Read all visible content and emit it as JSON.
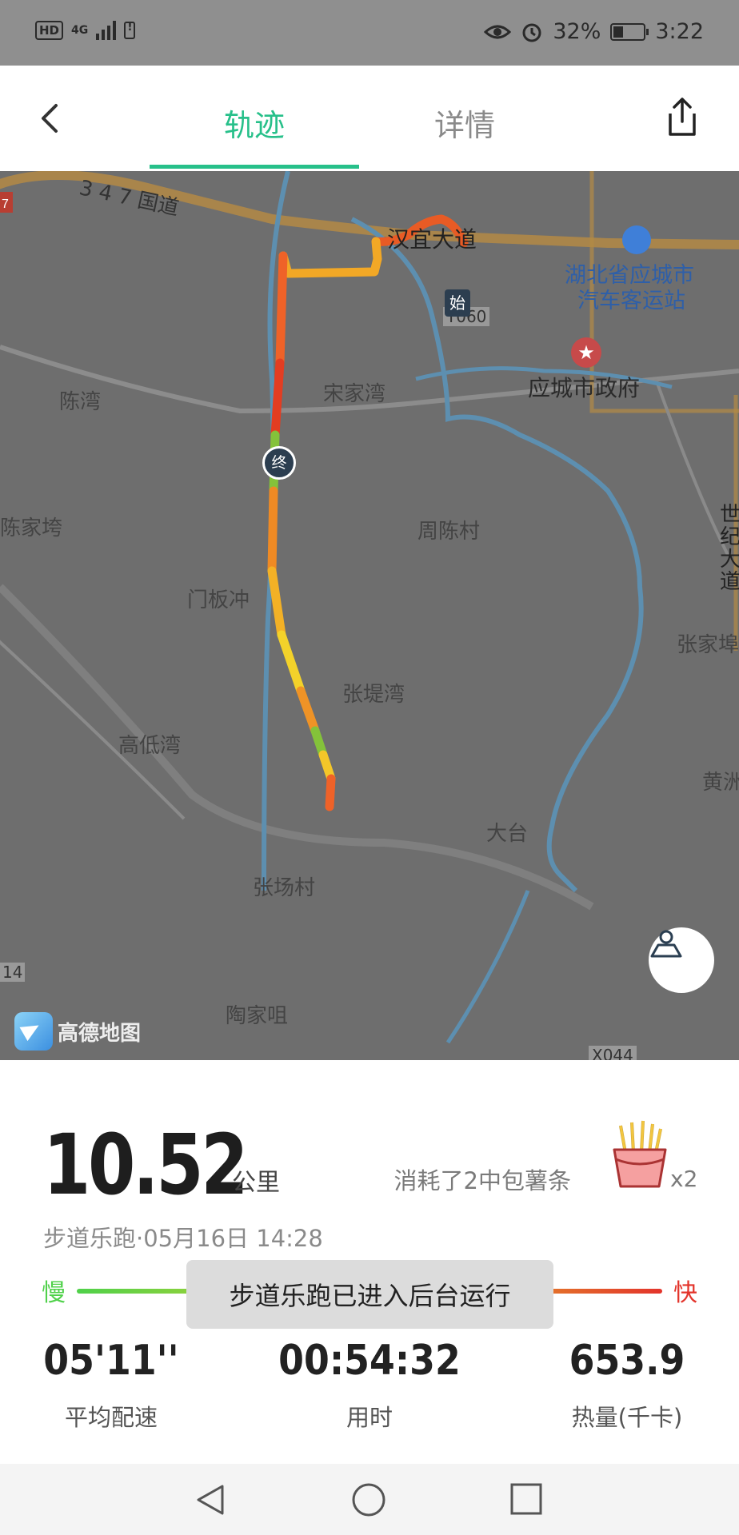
{
  "status_bar": {
    "left_icons": [
      "hd-icon",
      "4g-signal-icon",
      "sim-alert-icon"
    ],
    "network": "4G",
    "hd": "HD",
    "battery": "32%",
    "battery_level": 0.32,
    "time": "3:22"
  },
  "nav": {
    "tabs": [
      {
        "label": "轨迹",
        "active": true
      },
      {
        "label": "详情",
        "active": false
      }
    ],
    "accent": "#27c08a"
  },
  "map": {
    "labels": {
      "road_347": "3 4 7 国道",
      "hanyi_avenue": "汉宜大道",
      "bus_station_1": "湖北省应城市",
      "bus_station_2": "汽车客运站",
      "city_gov": "应城市政府",
      "chenwan": "陈湾",
      "songjiawan": "宋家湾",
      "chenjiawa": "陈家垮",
      "zhouchencun": "周陈村",
      "menbanchong": "门板冲",
      "zhangtiwan": "张堤湾",
      "gaodiwan": "高低湾",
      "datai": "大台",
      "zhangyangcun": "张场村",
      "taojiazui": "陶家咀",
      "shiji_avenue": "世纪大道",
      "zhangjia": "张家埠",
      "huang": "黄洲",
      "y060": "Y060",
      "x044": "X044",
      "edge_14": "14",
      "edge_7": "7",
      "provider": "高德地图"
    },
    "start_marker": "始",
    "end_marker": "终"
  },
  "stats": {
    "distance": "10.52",
    "distance_unit": "公里",
    "calories_text": "消耗了2中包薯条",
    "calories_multiplier": "x2",
    "subtitle": "步道乐跑·05月16日 14:28",
    "speed_slow": "慢",
    "speed_fast": "快",
    "speed_colors": [
      "#4fd14a",
      "#e4d22a",
      "#e3342b"
    ],
    "toast": "步道乐跑已进入后台运行",
    "metrics": [
      {
        "value": "05'11''",
        "label": "平均配速"
      },
      {
        "value": "00:54:32",
        "label": "用时"
      },
      {
        "value": "653.9",
        "label": "热量(千卡)"
      }
    ]
  }
}
